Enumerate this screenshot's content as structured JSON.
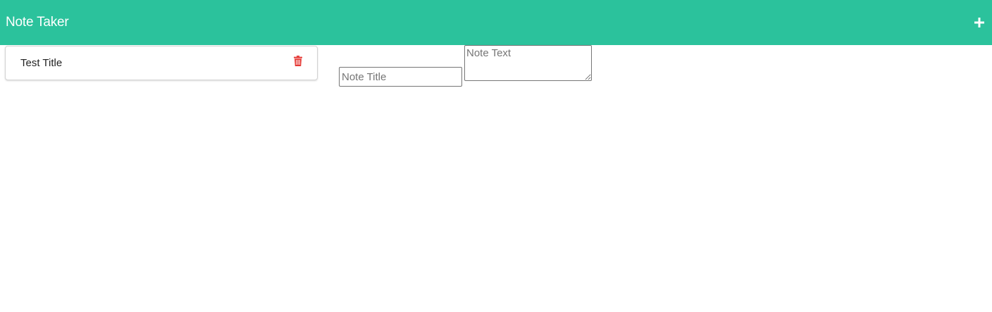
{
  "navbar": {
    "brand": "Note Taker",
    "new_note_icon": "plus-icon"
  },
  "notes": [
    {
      "title": "Test Title",
      "delete_icon": "trash-icon"
    }
  ],
  "editor": {
    "title_placeholder": "Note Title",
    "title_value": "",
    "text_placeholder": "Note Text",
    "text_value": ""
  },
  "colors": {
    "navbar_bg": "#2bc29c",
    "delete_icon": "#e53935"
  }
}
